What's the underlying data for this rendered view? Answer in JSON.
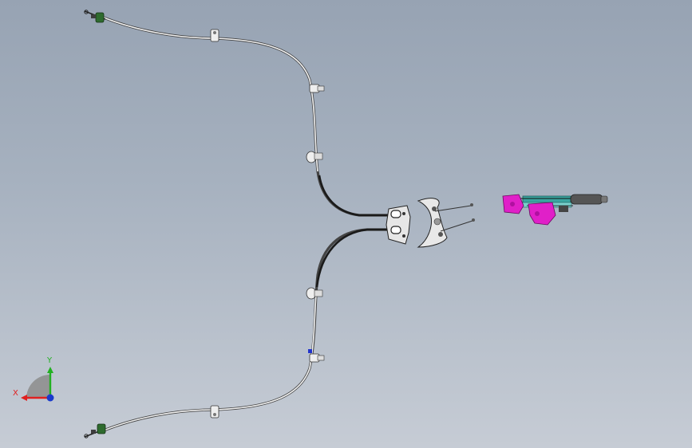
{
  "viewport": {
    "background_top": "#97a3b3",
    "background_bottom": "#c6ccd5"
  },
  "model": {
    "parts": [
      "upper-cable",
      "lower-cable",
      "upper-cable-end-fitting",
      "lower-cable-end-fitting",
      "cable-retaining-clips",
      "equalizer-bracket",
      "crescent-equalizer-plate",
      "tension-rods",
      "parking-brake-lever-assembly"
    ],
    "colors": {
      "cable": "#f2f2f2",
      "cable_conduit": "#1a1a1a",
      "clip": "#eeeeee",
      "end_fitting": "#2e6b2e",
      "lever_body": "#e020c8",
      "lever_frame": "#3aa5a0",
      "lever_grip": "#555555",
      "bracket": "#e6e6e6",
      "marker": "#2233cc"
    }
  },
  "triad": {
    "x_label": "X",
    "y_label": "Y",
    "x_color": "#e02020",
    "y_color": "#22b022",
    "z_color": "#1a3acc"
  }
}
